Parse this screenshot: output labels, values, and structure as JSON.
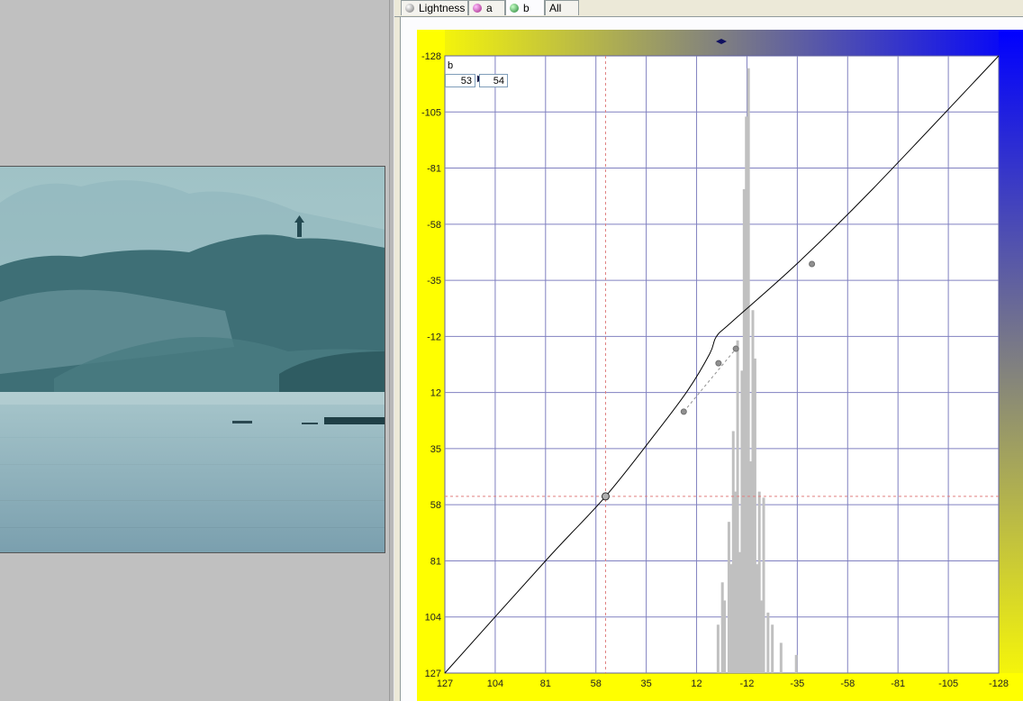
{
  "tabs": [
    {
      "label": "Lightness",
      "icon": "gray-ball-icon",
      "active": false
    },
    {
      "label": "a",
      "icon": "magenta-ball-icon",
      "active": false
    },
    {
      "label": "b",
      "icon": "green-ball-icon",
      "active": true
    },
    {
      "label": "All",
      "icon": "",
      "active": false
    }
  ],
  "curve_panel": {
    "channel_label": "b",
    "input_value": "53",
    "output_value": "54",
    "arrow_glyph": "▶"
  },
  "colors": {
    "yellow": "#ffff00",
    "blue": "#0000ff",
    "gray": "#808080",
    "grid": "#8080c0",
    "histogram": "#c0c0c0",
    "crosshair": "#e08080"
  },
  "chart_data": {
    "type": "line",
    "x_ticks": [
      "127",
      "104",
      "81",
      "58",
      "35",
      "12",
      "-12",
      "-35",
      "-58",
      "-81",
      "-105",
      "-128"
    ],
    "y_ticks": [
      "-128",
      "-105",
      "-81",
      "-58",
      "-35",
      "-12",
      "12",
      "35",
      "58",
      "81",
      "104",
      "127"
    ],
    "xlim": [
      127,
      -128
    ],
    "ylim": [
      127,
      -128
    ],
    "grid": true,
    "series": [
      {
        "points": [
          [
            127,
            127
          ],
          [
            80,
            80
          ],
          [
            53,
            54
          ],
          [
            30,
            28
          ],
          [
            15,
            10
          ],
          [
            5,
            -5
          ],
          [
            2,
            -12
          ],
          [
            -5,
            -18
          ],
          [
            -35,
            -42
          ],
          [
            -70,
            -73
          ],
          [
            -128,
            -128
          ]
        ]
      }
    ],
    "control_points": [
      [
        53,
        54
      ],
      [
        17,
        19
      ],
      [
        1,
        -1
      ],
      [
        -7,
        -7
      ],
      [
        -42,
        -42
      ]
    ],
    "crosshair": {
      "input": 53,
      "output": 54
    },
    "histogram": [
      {
        "x": 1,
        "h": 0.08
      },
      {
        "x": -1,
        "h": 0.15
      },
      {
        "x": -2,
        "h": 0.12
      },
      {
        "x": -4,
        "h": 0.25
      },
      {
        "x": -5,
        "h": 0.18
      },
      {
        "x": -6,
        "h": 0.4
      },
      {
        "x": -7,
        "h": 0.3
      },
      {
        "x": -8,
        "h": 0.55
      },
      {
        "x": -9,
        "h": 0.2
      },
      {
        "x": -10,
        "h": 0.5
      },
      {
        "x": -11,
        "h": 0.8
      },
      {
        "x": -12,
        "h": 0.92
      },
      {
        "x": -13,
        "h": 1.0
      },
      {
        "x": -14,
        "h": 0.35
      },
      {
        "x": -15,
        "h": 0.6
      },
      {
        "x": -16,
        "h": 0.52
      },
      {
        "x": -17,
        "h": 0.18
      },
      {
        "x": -18,
        "h": 0.3
      },
      {
        "x": -19,
        "h": 0.12
      },
      {
        "x": -20,
        "h": 0.29
      },
      {
        "x": -22,
        "h": 0.1
      },
      {
        "x": -24,
        "h": 0.08
      },
      {
        "x": -28,
        "h": 0.05
      },
      {
        "x": -35,
        "h": 0.03
      }
    ]
  }
}
